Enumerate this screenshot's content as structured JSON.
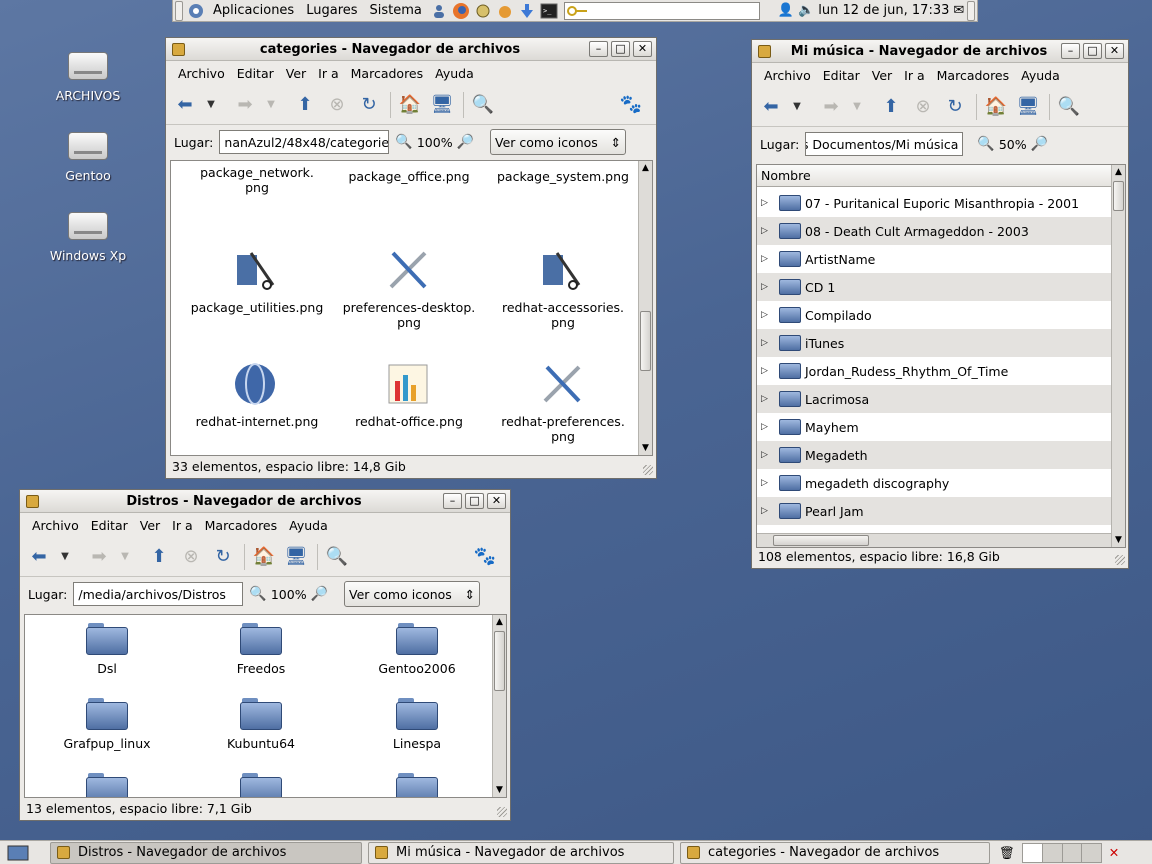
{
  "top_panel": {
    "menus": [
      "Aplicaciones",
      "Lugares",
      "Sistema"
    ],
    "launchers": [
      "users-icon",
      "firefox-icon",
      "applet-icon",
      "gimp-icon",
      "download-icon",
      "terminal-icon"
    ],
    "clock": "lun 12 de jun, 17:33"
  },
  "desktop": {
    "icons": [
      "ARCHIVOS",
      "Gentoo",
      "Windows Xp"
    ]
  },
  "common_menu": [
    "Archivo",
    "Editar",
    "Ver",
    "Ir a",
    "Marcadores",
    "Ayuda"
  ],
  "location_label": "Lugar:",
  "win_categories": {
    "title": "categories - Navegador de archivos",
    "location": "nanAzul2/48x48/categories",
    "zoom": "100%",
    "view": "Ver como iconos",
    "files": [
      "package_network.\npng",
      "package_office.png",
      "package_system.png",
      "package_utilities.png",
      "preferences-desktop.\npng",
      "redhat-accessories.\npng",
      "redhat-internet.png",
      "redhat-office.png",
      "redhat-preferences.\npng"
    ],
    "status": "33 elementos, espacio libre: 14,8 Gib"
  },
  "win_musica": {
    "title": "Mi música - Navegador de archivos",
    "location": "s Documentos/Mi música",
    "zoom": "50%",
    "column": "Nombre",
    "rows": [
      "07 - Puritanical Euporic Misanthropia - 2001",
      "08 - Death Cult Armageddon - 2003",
      "ArtistName",
      "CD 1",
      "Compilado",
      "iTunes",
      "Jordan_Rudess_Rhythm_Of_Time",
      "Lacrimosa",
      "Mayhem",
      "Megadeth",
      "megadeth discography",
      "Pearl Jam"
    ],
    "status": "108 elementos, espacio libre: 16,8 Gib"
  },
  "win_distros": {
    "title": "Distros - Navegador de archivos",
    "location": "/media/archivos/Distros",
    "zoom": "100%",
    "view": "Ver como iconos",
    "folders": [
      "Dsl",
      "Freedos",
      "Gentoo2006",
      "Grafpup_linux",
      "Kubuntu64",
      "Linespa"
    ],
    "status": "13 elementos, espacio libre: 7,1 Gib"
  },
  "taskbar": {
    "tasks": [
      "Distros - Navegador de archivos",
      "Mi música - Navegador de archivos",
      "categories - Navegador de archivos"
    ]
  }
}
